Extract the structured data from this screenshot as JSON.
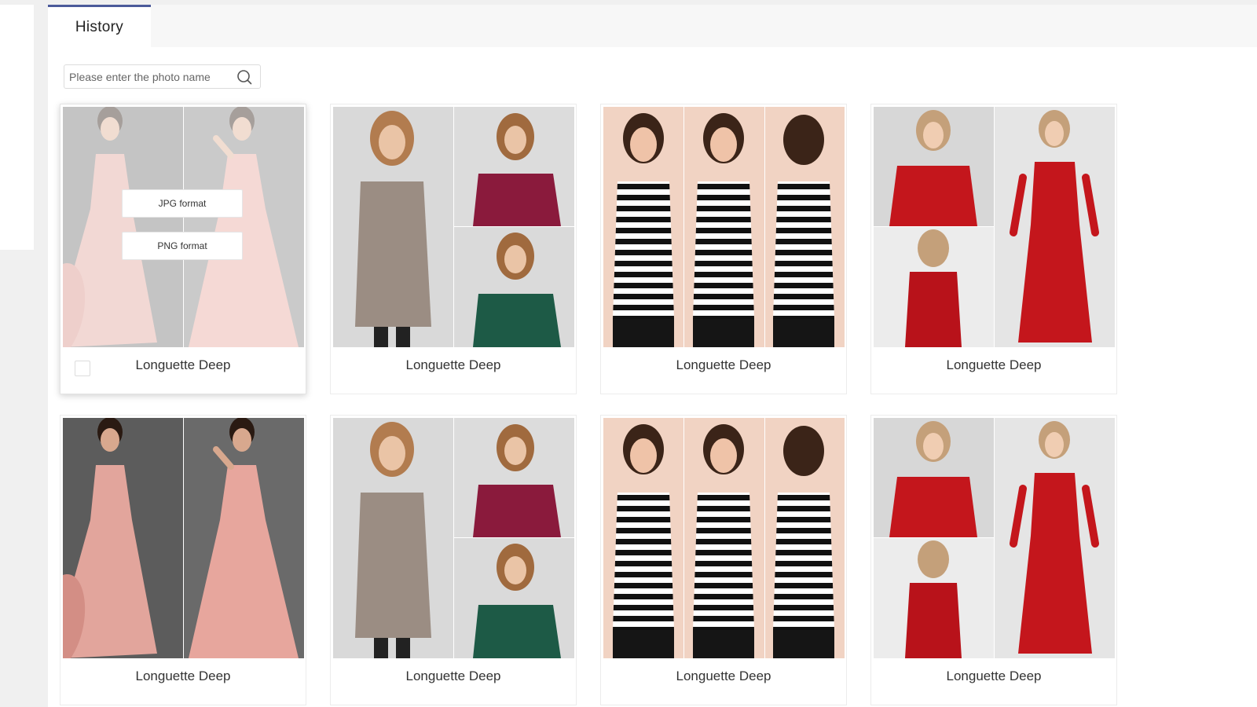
{
  "tabs": [
    {
      "label": "History",
      "active": true
    }
  ],
  "search": {
    "placeholder": "Please enter the photo name",
    "value": ""
  },
  "hover_menu": {
    "jpg_label": "JPG format",
    "png_label": "PNG format"
  },
  "colors": {
    "accent": "#4b5a9a",
    "background": "#f0f0f0"
  },
  "photos": [
    {
      "name": "Longuette Deep",
      "image": "pink-gown-collage",
      "hovered": true,
      "checked": false
    },
    {
      "name": "Longuette Deep",
      "image": "sweater-collage"
    },
    {
      "name": "Longuette Deep",
      "image": "striped-tank-collage"
    },
    {
      "name": "Longuette Deep",
      "image": "red-dress-collage"
    },
    {
      "name": "Longuette Deep",
      "image": "pink-gown-collage"
    },
    {
      "name": "Longuette Deep",
      "image": "sweater-collage"
    },
    {
      "name": "Longuette Deep",
      "image": "striped-tank-collage"
    },
    {
      "name": "Longuette Deep",
      "image": "red-dress-collage"
    }
  ]
}
